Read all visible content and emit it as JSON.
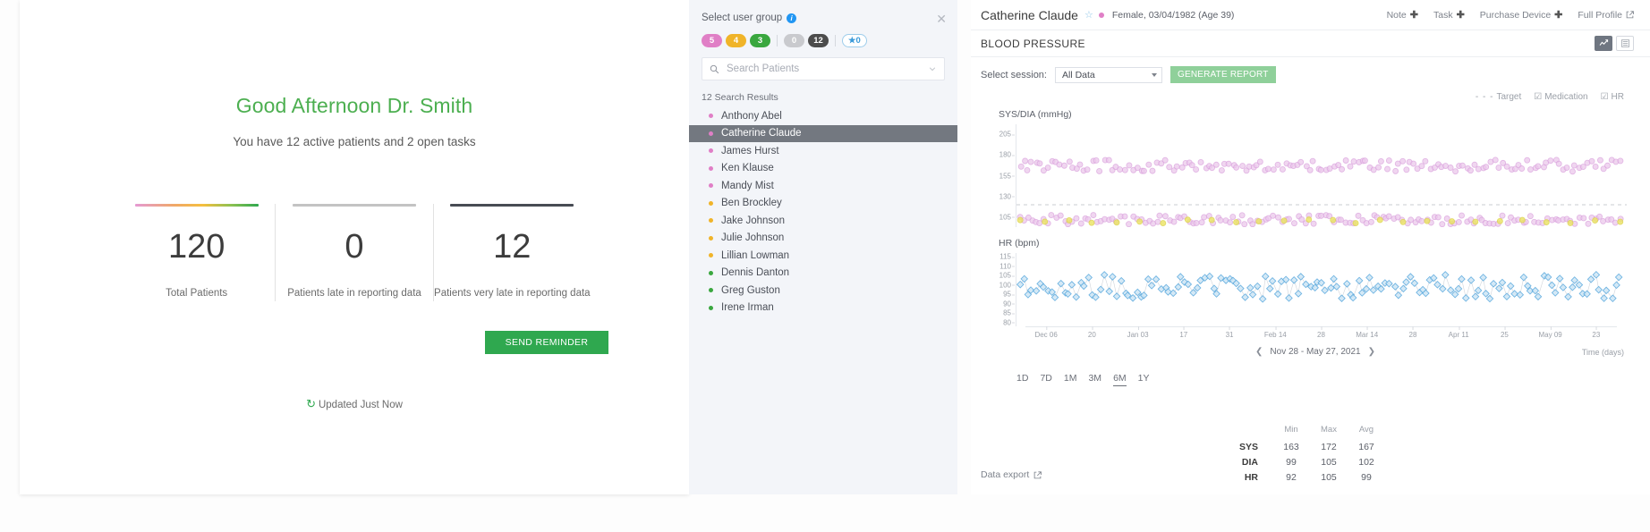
{
  "dashboard": {
    "greeting": "Good Afternoon Dr. Smith",
    "subgreeting": "You have 12 active patients and 2 open tasks",
    "stats": [
      {
        "value": "120",
        "label": "Total Patients",
        "bar": "gradient"
      },
      {
        "value": "0",
        "label": "Patients late in reporting data",
        "bar": "grey"
      },
      {
        "value": "12",
        "label": "Patients very late in reporting data",
        "bar": "dark"
      }
    ],
    "send_reminder_label": "SEND REMINDER",
    "updated_text": "Updated Just Now",
    "refresh_icon": "refresh-icon"
  },
  "patients_panel": {
    "select_group_label": "Select user group",
    "info_icon": "info-icon",
    "close_icon": "close-icon",
    "badges": [
      {
        "value": "5",
        "style": "pink"
      },
      {
        "value": "4",
        "style": "amber"
      },
      {
        "value": "3",
        "style": "green"
      },
      {
        "sep": true
      },
      {
        "value": "0",
        "style": "grey"
      },
      {
        "value": "12",
        "style": "dark"
      },
      {
        "sep": true
      },
      {
        "value": "★0",
        "style": "star"
      }
    ],
    "search": {
      "placeholder": "Search Patients",
      "value": "",
      "icon": "search-icon",
      "chevron": "chevron-down-icon"
    },
    "results_count": "12 Search Results",
    "list": [
      {
        "name": "Anthony Abel",
        "dot": "pink",
        "selected": false
      },
      {
        "name": "Catherine Claude",
        "dot": "pink",
        "selected": true
      },
      {
        "name": "James Hurst",
        "dot": "pink",
        "selected": false
      },
      {
        "name": "Ken Klause",
        "dot": "pink",
        "selected": false
      },
      {
        "name": "Mandy Mist",
        "dot": "pink",
        "selected": false
      },
      {
        "name": "Ben Brockley",
        "dot": "amber",
        "selected": false
      },
      {
        "name": "Jake Johnson",
        "dot": "amber",
        "selected": false
      },
      {
        "name": "Julie Johnson",
        "dot": "amber",
        "selected": false
      },
      {
        "name": "Lillian Lowman",
        "dot": "amber",
        "selected": false
      },
      {
        "name": "Dennis Danton",
        "dot": "green",
        "selected": false
      },
      {
        "name": "Greg Guston",
        "dot": "green",
        "selected": false
      },
      {
        "name": "Irene Irman",
        "dot": "green",
        "selected": false
      }
    ]
  },
  "detail": {
    "patient_name": "Catherine Claude",
    "demographics": "Female, 03/04/1982 (Age 39)",
    "star_icon": "star-outline-icon",
    "status_dot_color": "#e07fc6",
    "header_actions": [
      {
        "label": "Note",
        "icon": "plus-icon"
      },
      {
        "label": "Task",
        "icon": "plus-icon"
      },
      {
        "label": "Purchase Device",
        "icon": "plus-icon"
      },
      {
        "label": "Full Profile",
        "icon": "external-link-icon"
      }
    ],
    "section_title": "BLOOD PRESSURE",
    "view_toggle": [
      {
        "icon": "line-chart-icon",
        "active": true
      },
      {
        "icon": "table-list-icon",
        "active": false
      }
    ],
    "session_label": "Select session:",
    "session_value": "All Data",
    "generate_report_label": "GENERATE REPORT",
    "legend": [
      {
        "label": "Target",
        "marker": "dashed"
      },
      {
        "label": "Medication",
        "marker": "checkbox"
      },
      {
        "label": "HR",
        "marker": "checkbox"
      }
    ],
    "range_nav": {
      "label": "Nov 28 - May 27, 2021",
      "prev_icon": "chevron-left-icon",
      "next_icon": "chevron-right-icon"
    },
    "time_axis_label": "Time (days)",
    "range_buttons": [
      {
        "label": "1D",
        "active": false
      },
      {
        "label": "7D",
        "active": false
      },
      {
        "label": "1M",
        "active": false
      },
      {
        "label": "3M",
        "active": false
      },
      {
        "label": "6M",
        "active": true
      },
      {
        "label": "1Y",
        "active": false
      }
    ],
    "stats_table": {
      "columns": [
        "",
        "Min",
        "Max",
        "Avg"
      ],
      "rows": [
        {
          "label": "SYS",
          "min": "163",
          "max": "172",
          "avg": "167"
        },
        {
          "label": "DIA",
          "min": "99",
          "max": "105",
          "avg": "102"
        },
        {
          "label": "HR",
          "min": "92",
          "max": "105",
          "avg": "99"
        }
      ]
    },
    "data_export_label": "Data export",
    "data_export_icon": "external-link-icon"
  },
  "chart_data": [
    {
      "type": "scatter",
      "title": "SYS/DIA (mmHg)",
      "ylabel": "SYS/DIA (mmHg)",
      "xlabel": "Time (days)",
      "ylim": [
        93,
        217
      ],
      "yticks": [
        205,
        180,
        155,
        130,
        105
      ],
      "xticks": [
        "Dec 06",
        "20",
        "Jan 03",
        "17",
        "31",
        "Feb 14",
        "28",
        "Mar 14",
        "28",
        "Apr 11",
        "25",
        "May 09",
        "23"
      ],
      "x_range": [
        "Nov 28",
        "May 27, 2021"
      ],
      "grid": false,
      "target_line": {
        "value": 120,
        "style": "dashed",
        "color": "#c8ccd2"
      },
      "series": [
        {
          "name": "SYS",
          "color": "#d9a0dc",
          "mean": 167,
          "min": 163,
          "max": 172
        },
        {
          "name": "DIA",
          "color": "#d9a0dc",
          "mean": 102,
          "min": 99,
          "max": 105
        },
        {
          "name": "Medication",
          "color": "#e8e05a",
          "mean": 100
        }
      ]
    },
    {
      "type": "scatter",
      "title": "HR (bpm)",
      "ylabel": "HR (bpm)",
      "xlabel": "Time (days)",
      "ylim": [
        78,
        117
      ],
      "yticks": [
        115,
        110,
        105,
        100,
        95,
        90,
        85,
        80
      ],
      "xticks": [
        "Dec 06",
        "20",
        "Jan 03",
        "17",
        "31",
        "Feb 14",
        "28",
        "Mar 14",
        "28",
        "Apr 11",
        "25",
        "May 09",
        "23"
      ],
      "grid": false,
      "series": [
        {
          "name": "HR",
          "color": "#58a8dd",
          "mean": 99,
          "min": 92,
          "max": 105
        }
      ]
    }
  ]
}
